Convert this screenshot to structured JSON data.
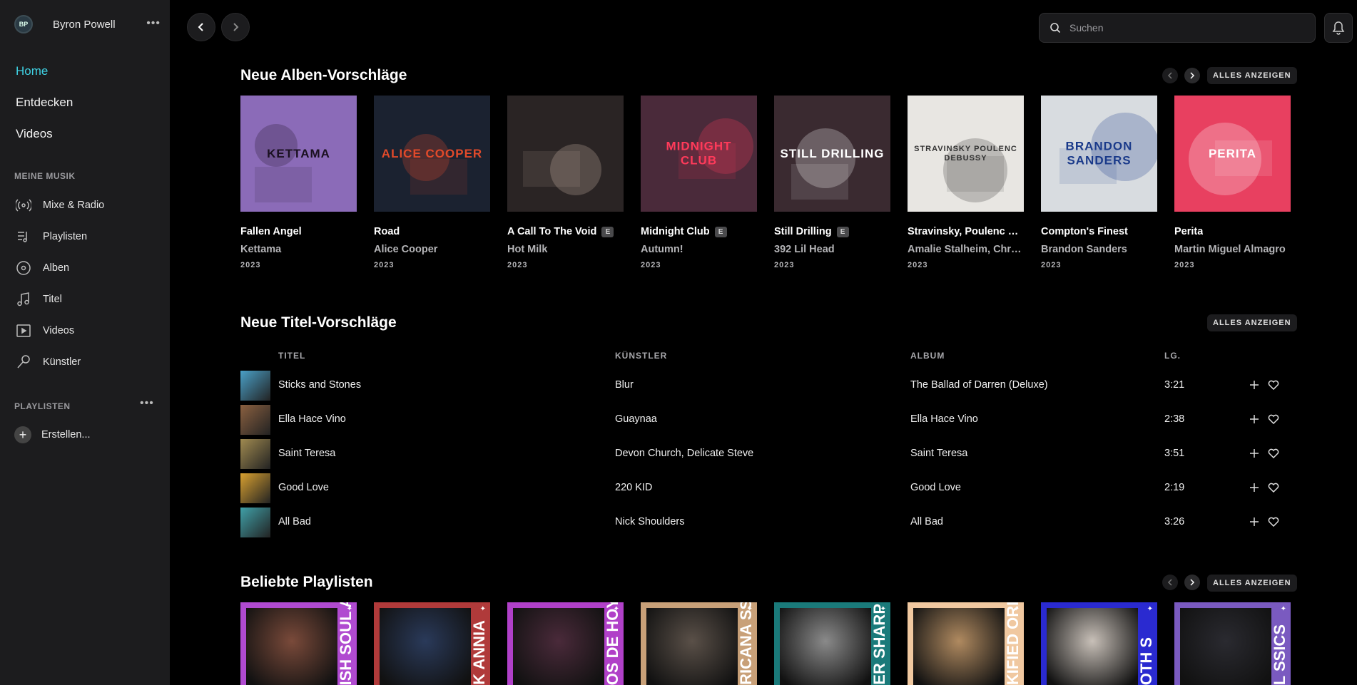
{
  "user": {
    "initials": "BP",
    "name": "Byron Powell"
  },
  "nav": {
    "home": "Home",
    "discover": "Entdecken",
    "videos": "Videos"
  },
  "my_music": {
    "heading": "MEINE MUSIK",
    "items": [
      {
        "label": "Mixe & Radio",
        "icon": "radio-icon"
      },
      {
        "label": "Playlisten",
        "icon": "playlist-icon"
      },
      {
        "label": "Alben",
        "icon": "album-icon"
      },
      {
        "label": "Titel",
        "icon": "note-icon"
      },
      {
        "label": "Videos",
        "icon": "video-icon"
      },
      {
        "label": "Künstler",
        "icon": "microphone-icon"
      }
    ]
  },
  "playlists": {
    "heading": "PLAYLISTEN",
    "create_label": "Erstellen..."
  },
  "search": {
    "placeholder": "Suchen"
  },
  "sections": {
    "albums_title": "Neue Alben-Vorschläge",
    "tracks_title": "Neue Titel-Vorschläge",
    "playlists_title": "Beliebte Playlisten",
    "see_all": "ALLES ANZEIGEN"
  },
  "albums": [
    {
      "title": "Fallen Angel",
      "artist": "Kettama",
      "year": "2023",
      "explicit": false,
      "cover_text": "KETTAMA",
      "bg": "#8b6bb8",
      "fg": "#1a1020"
    },
    {
      "title": "Road",
      "artist": "Alice Cooper",
      "year": "2023",
      "explicit": false,
      "cover_text": "ALICE COOPER",
      "bg": "#1b2230",
      "fg": "#e24a2a"
    },
    {
      "title": "A Call To The Void",
      "artist": "Hot Milk",
      "year": "2023",
      "explicit": true,
      "cover_text": "",
      "bg": "#2a2424",
      "fg": "#d8c0b0"
    },
    {
      "title": "Midnight Club",
      "artist": "Autumn!",
      "year": "2023",
      "explicit": true,
      "cover_text": "MIDNIGHT CLUB",
      "bg": "#4a2a3a",
      "fg": "#ff3a5a"
    },
    {
      "title": "Still Drilling",
      "artist": "392 Lil Head",
      "year": "2023",
      "explicit": true,
      "cover_text": "STILL DRILLING",
      "bg": "#3a2a30",
      "fg": "#ffffff"
    },
    {
      "title": "Stravinsky, Poulenc & Debussy",
      "artist": "Amalie Stalheim, Christian Ihle Hadland",
      "year": "2023",
      "explicit": false,
      "cover_text": "STRAVINSKY POULENC DEBUSSY",
      "bg": "#e8e6e2",
      "fg": "#333333"
    },
    {
      "title": "Compton's Finest",
      "artist": "Brandon Sanders",
      "year": "2023",
      "explicit": false,
      "cover_text": "BRANDON SANDERS",
      "bg": "#d8dce0",
      "fg": "#1a3a8a"
    },
    {
      "title": "Perita",
      "artist": "Martin Miguel Almagro",
      "year": "2023",
      "explicit": false,
      "cover_text": "PERITA",
      "bg": "#e84060",
      "fg": "#ffffff"
    }
  ],
  "track_headers": {
    "title": "TITEL",
    "artist": "KÜNSTLER",
    "album": "ALBUM",
    "duration": "LG."
  },
  "tracks": [
    {
      "title": "Sticks and Stones",
      "artist": "Blur",
      "album": "The Ballad of Darren (Deluxe)",
      "duration": "3:21",
      "thumb": "#4aa0c8"
    },
    {
      "title": "Ella Hace Vino",
      "artist": "Guaynaa",
      "album": "Ella Hace Vino",
      "duration": "2:38",
      "thumb": "#8a6040"
    },
    {
      "title": "Saint Teresa",
      "artist": "Devon Church, Delicate Steve",
      "album": "Saint Teresa",
      "duration": "3:51",
      "thumb": "#a08a50"
    },
    {
      "title": "Good Love",
      "artist": "220 KID",
      "album": "Good Love",
      "duration": "2:19",
      "thumb": "#d8a030"
    },
    {
      "title": "All Bad",
      "artist": "Nick Shoulders",
      "album": "All Bad",
      "duration": "3:26",
      "thumb": "#40a0a8"
    }
  ],
  "playlist_cards": [
    {
      "text": "ISH SOUL\nASION",
      "bg": "#b04ad0",
      "photo": "#7a4a3a",
      "fg": "#ffffff"
    },
    {
      "text": "K\nANNIA",
      "bg": "#b03a3a",
      "photo": "#2a3a5a",
      "fg": "#ffffff"
    },
    {
      "text": "OS DE HOY",
      "bg": "#b040c8",
      "photo": "#4a2a3a",
      "fg": "#ffffff"
    },
    {
      "text": "RICANA\nSSICS",
      "bg": "#c8a078",
      "photo": "#5a5048",
      "fg": "#ffffff"
    },
    {
      "text": "ER SHARP",
      "bg": "#1a7a7a",
      "photo": "#8a8a8a",
      "fg": "#ffffff"
    },
    {
      "text": "KIFIED\nORITES",
      "bg": "#f0c8a0",
      "photo": "#b08a60",
      "fg": "#ffffff"
    },
    {
      "text": "OTH\nS",
      "bg": "#2a2ad0",
      "photo": "#c8c0b8",
      "fg": "#ffffff"
    },
    {
      "text": "L\nSSICS",
      "bg": "#7a5ac0",
      "photo": "#2a2a30",
      "fg": "#ffffff"
    }
  ],
  "colors": {
    "accent": "#3fd2e4",
    "sidebar": "#1c1c1e",
    "background": "#000000"
  }
}
